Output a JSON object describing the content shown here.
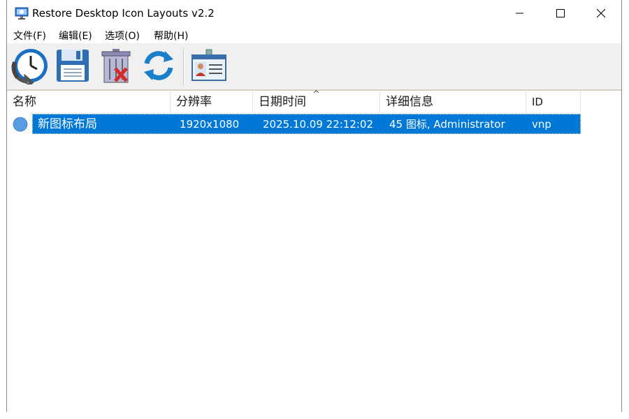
{
  "window": {
    "title": "Restore Desktop Icon Layouts v2.2",
    "controls": {
      "minimize": "minimize-icon",
      "maximize": "maximize-icon",
      "close": "close-icon"
    }
  },
  "menu": [
    {
      "label": "文件(F)"
    },
    {
      "label": "编辑(E)"
    },
    {
      "label": "选项(O)"
    },
    {
      "label": "帮助(H)"
    }
  ],
  "toolbar": [
    {
      "icon": "restore-clock-icon"
    },
    {
      "icon": "save-floppy-icon"
    },
    {
      "icon": "delete-trash-icon"
    },
    {
      "icon": "refresh-icon"
    },
    {
      "icon": "id-card-icon"
    }
  ],
  "list": {
    "columns": [
      "名称",
      "分辨率",
      "日期时间",
      "详细信息",
      "ID"
    ],
    "sort_indicator": "^",
    "rows": [
      {
        "name": "新图标布局",
        "resolution": "1920x1080",
        "datetime": "2025.10.09 22:12:02",
        "details": "45 图标, Administrator",
        "id": "vnp",
        "selected": true
      }
    ]
  },
  "colors": {
    "selection": "#0078d7",
    "toolbar_bg": "#f0f0f0"
  }
}
